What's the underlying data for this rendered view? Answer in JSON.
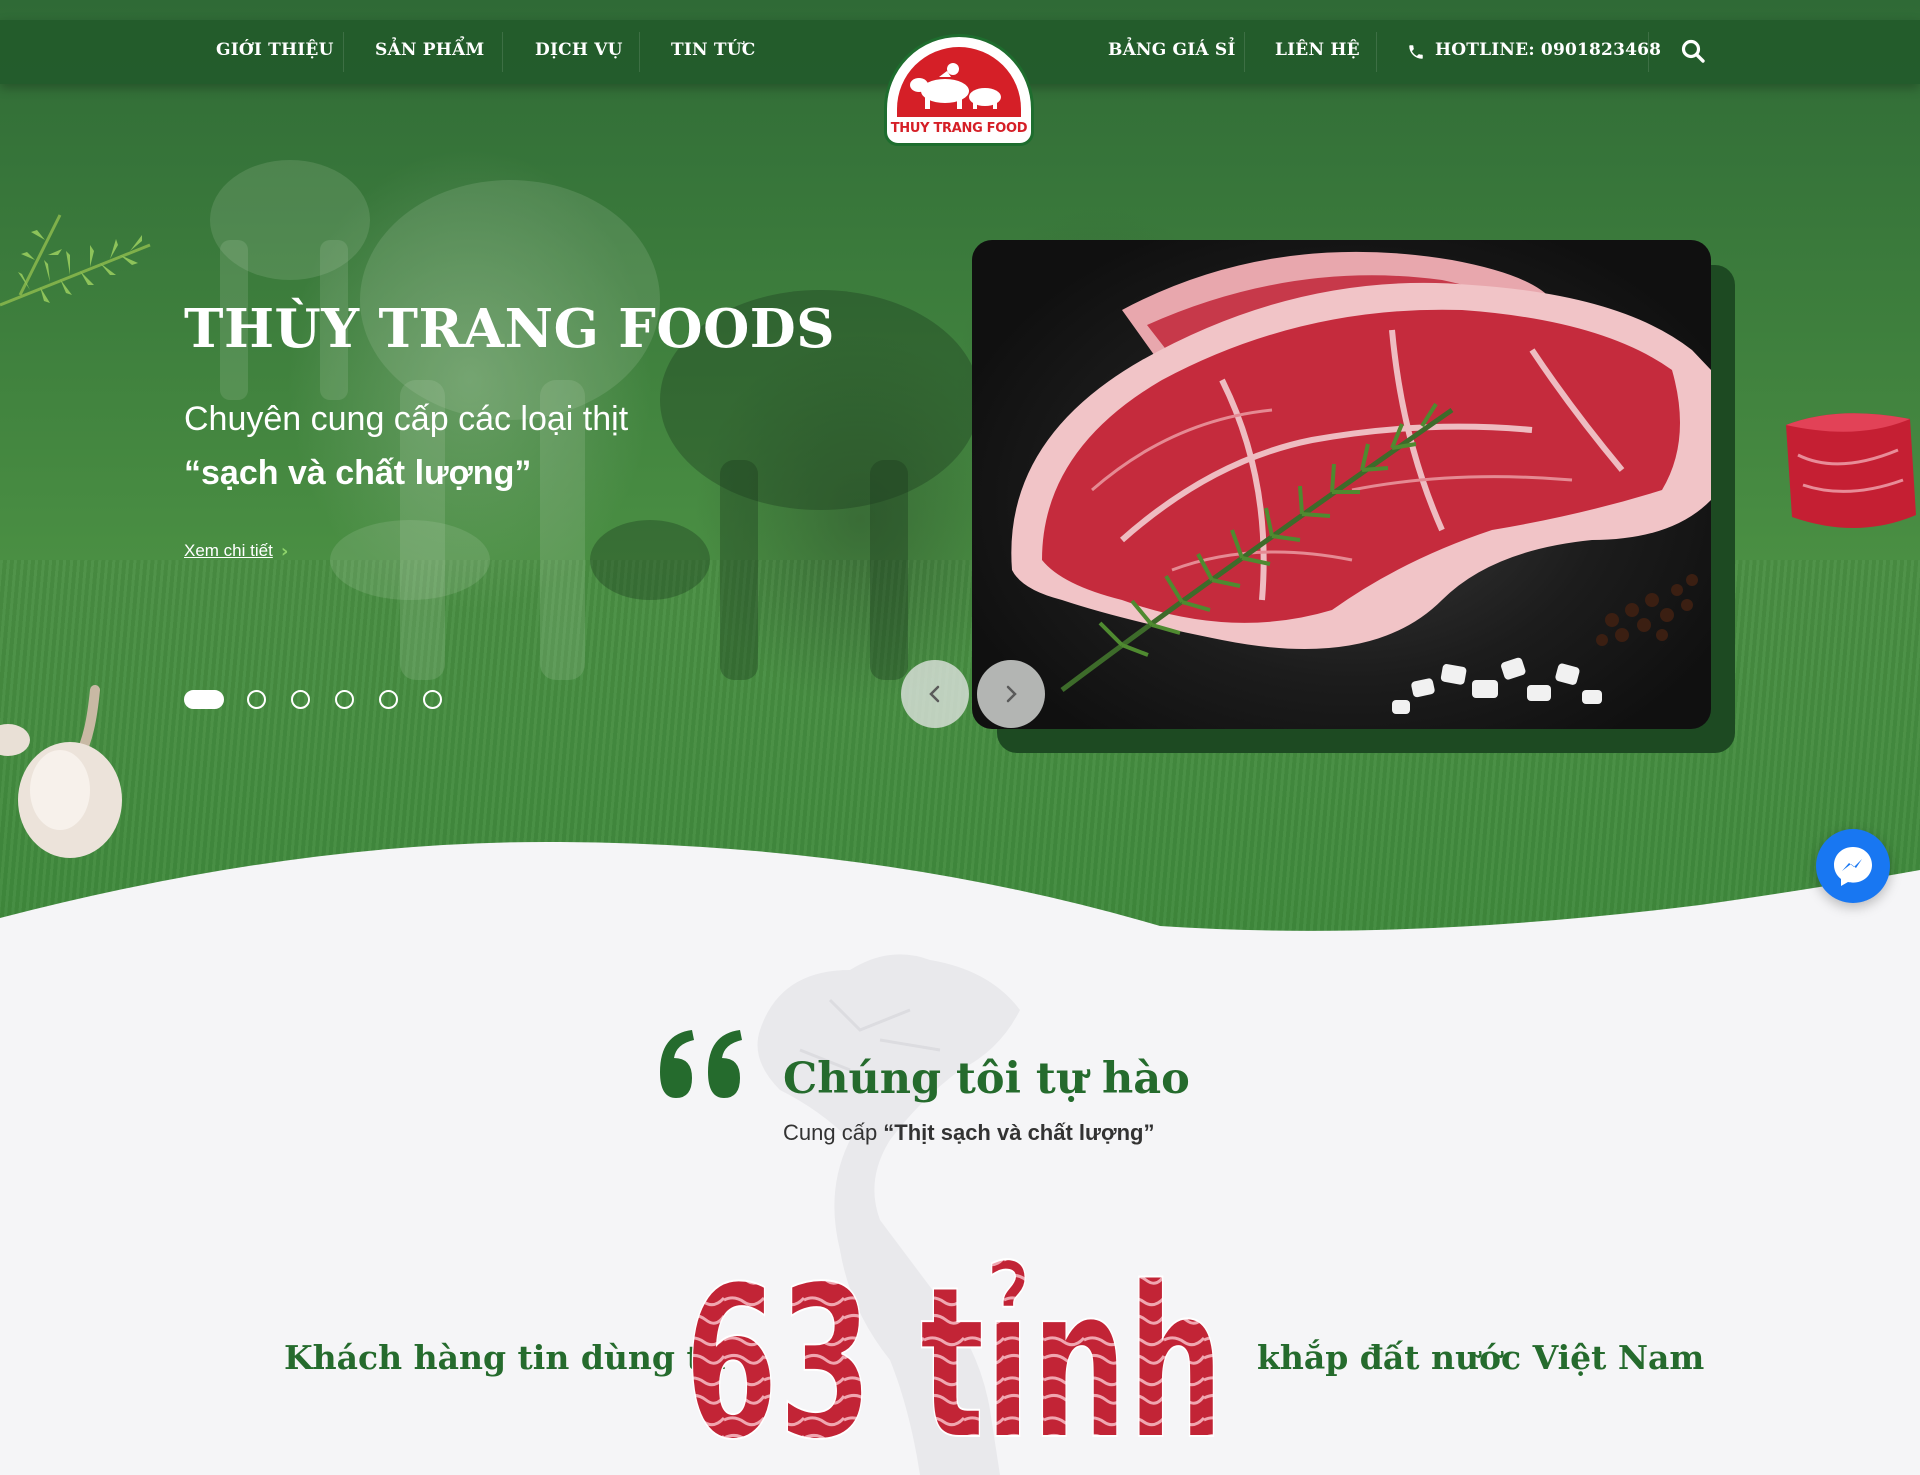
{
  "nav": {
    "items_left": [
      "GIỚI THIỆU",
      "SẢN PHẨM",
      "DỊCH VỤ",
      "TIN TỨC"
    ],
    "items_right": [
      "BẢNG GIÁ SỈ",
      "LIÊN HỆ"
    ],
    "hotline": "HOTLINE: 0901823468",
    "icons": {
      "phone": "phone-icon",
      "search": "search-icon"
    }
  },
  "logo": {
    "text": "THUY TRANG FOOD"
  },
  "hero": {
    "title": "THÙY TRANG FOODS",
    "subtitle": "Chuyên cung cấp các loại thịt",
    "quote": "“sạch và chất lượng”",
    "link": "Xem chi tiết",
    "slide_count": 6,
    "active_slide": 1
  },
  "pride": {
    "title": "Chúng tôi tự hào",
    "sub_prefix": "Cung cấp ",
    "sub_bold": "“Thịt sạch và chất lượng”"
  },
  "stats": {
    "left": "Khách hàng tin dùng từ",
    "big": "63 tỉnh",
    "right": "khắp đất nước Việt Nam"
  },
  "colors": {
    "brand_green": "#256b2d",
    "nav_green": "#215a2a",
    "brand_red": "#d51f27",
    "messenger_blue": "#1877f2"
  }
}
